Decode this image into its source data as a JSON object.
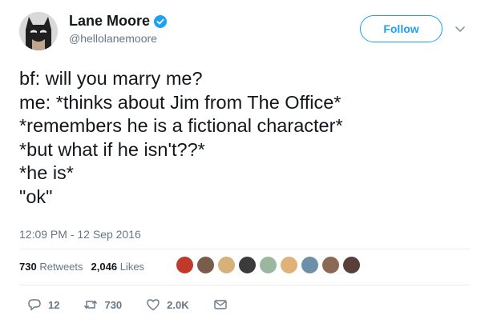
{
  "author": {
    "display_name": "Lane Moore",
    "handle": "@hellolanemoore",
    "verified": true
  },
  "follow_button": {
    "label": "Follow"
  },
  "tweet": {
    "lines": [
      "bf: will you marry me?",
      "me: *thinks about Jim from The Office*",
      "*remembers he is a fictional character*",
      "*but what if he isn't??*",
      "*he is*",
      "\"ok\""
    ],
    "timestamp": "12:09 PM - 12 Sep 2016"
  },
  "stats": {
    "retweets_count": "730",
    "retweets_label": "Retweets",
    "likes_count": "2,046",
    "likes_label": "Likes"
  },
  "likers": {
    "colors": [
      "#c0392b",
      "#7a5c4a",
      "#d8b07a",
      "#3b3b3b",
      "#9bb7a0",
      "#e0b27a",
      "#6d8fa8",
      "#8a6a55",
      "#5a3e3a"
    ]
  },
  "actions": {
    "reply_count": "12",
    "retweet_count": "730",
    "like_count": "2.0K"
  },
  "colors": {
    "accent": "#1da1f2",
    "text": "#14171a",
    "secondary": "#657786",
    "divider": "#e6ecf0"
  }
}
